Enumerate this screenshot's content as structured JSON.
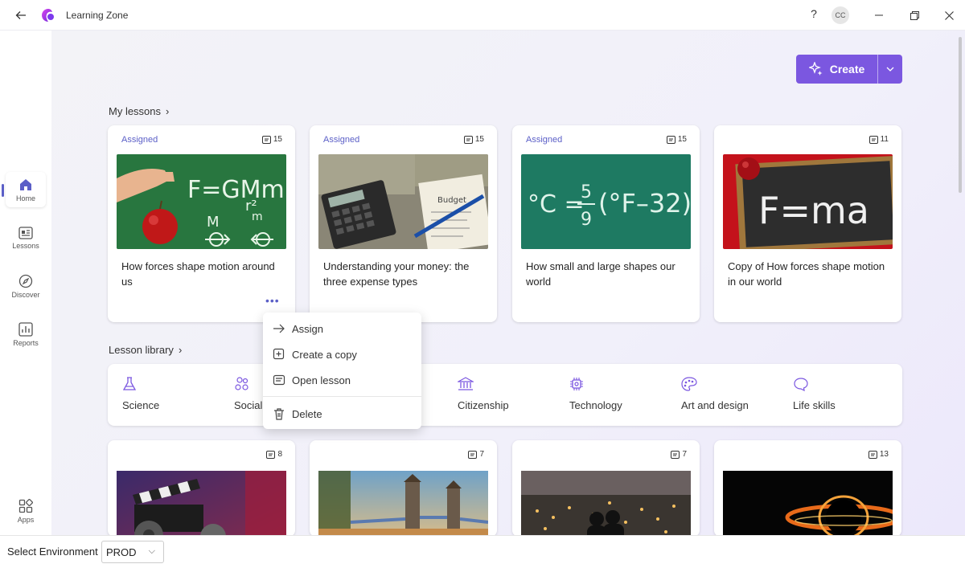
{
  "window": {
    "title": "Learning Zone",
    "help": "?",
    "avatar_initials": "CC"
  },
  "sidebar": {
    "items": [
      {
        "label": "Home",
        "icon": "home-icon",
        "active": true
      },
      {
        "label": "Lessons",
        "icon": "lessons-icon"
      },
      {
        "label": "Discover",
        "icon": "discover-icon"
      },
      {
        "label": "Reports",
        "icon": "reports-icon"
      },
      {
        "label": "Apps",
        "icon": "apps-icon"
      }
    ]
  },
  "create": {
    "label": "Create",
    "accent": "#7b57e0"
  },
  "my_lessons": {
    "title": "My lessons",
    "cards": [
      {
        "status": "Assigned",
        "count": "15",
        "title": "How forces shape motion around us",
        "thumb": "physics-chalkboard-apple",
        "more": "•••"
      },
      {
        "status": "Assigned",
        "count": "15",
        "title": "Understanding your money: the three expense types",
        "thumb": "calculator-budget"
      },
      {
        "status": "Assigned",
        "count": "15",
        "title": "How small and large shapes our world",
        "thumb": "temperature-formula-chalkboard"
      },
      {
        "status": "",
        "count": "11",
        "title": "Copy of How forces shape motion in our world",
        "thumb": "f-equals-ma-chalkboard"
      }
    ]
  },
  "library": {
    "title": "Lesson library",
    "subjects": [
      {
        "label": "Science",
        "icon": "flask-icon"
      },
      {
        "label": "Social",
        "icon": "people-icon"
      },
      {
        "label": "Citizenship",
        "icon": "building-icon"
      },
      {
        "label": "Technology",
        "icon": "chip-icon"
      },
      {
        "label": "Art and design",
        "icon": "palette-icon"
      },
      {
        "label": "Life skills",
        "icon": "chat-icon"
      }
    ],
    "cards": [
      {
        "count": "8",
        "thumb": "film-clapperboard"
      },
      {
        "count": "7",
        "thumb": "tower-bridge"
      },
      {
        "count": "7",
        "thumb": "city-night-skyline"
      },
      {
        "count": "13",
        "thumb": "black-hole"
      }
    ]
  },
  "context_menu": {
    "items": [
      {
        "label": "Assign",
        "icon": "arrow-right-icon"
      },
      {
        "label": "Create a copy",
        "icon": "copy-icon"
      },
      {
        "label": "Open lesson",
        "icon": "open-lesson-icon"
      },
      {
        "label": "Delete",
        "icon": "trash-icon"
      }
    ]
  },
  "environment": {
    "label": "Select Environment",
    "value": "PROD"
  }
}
